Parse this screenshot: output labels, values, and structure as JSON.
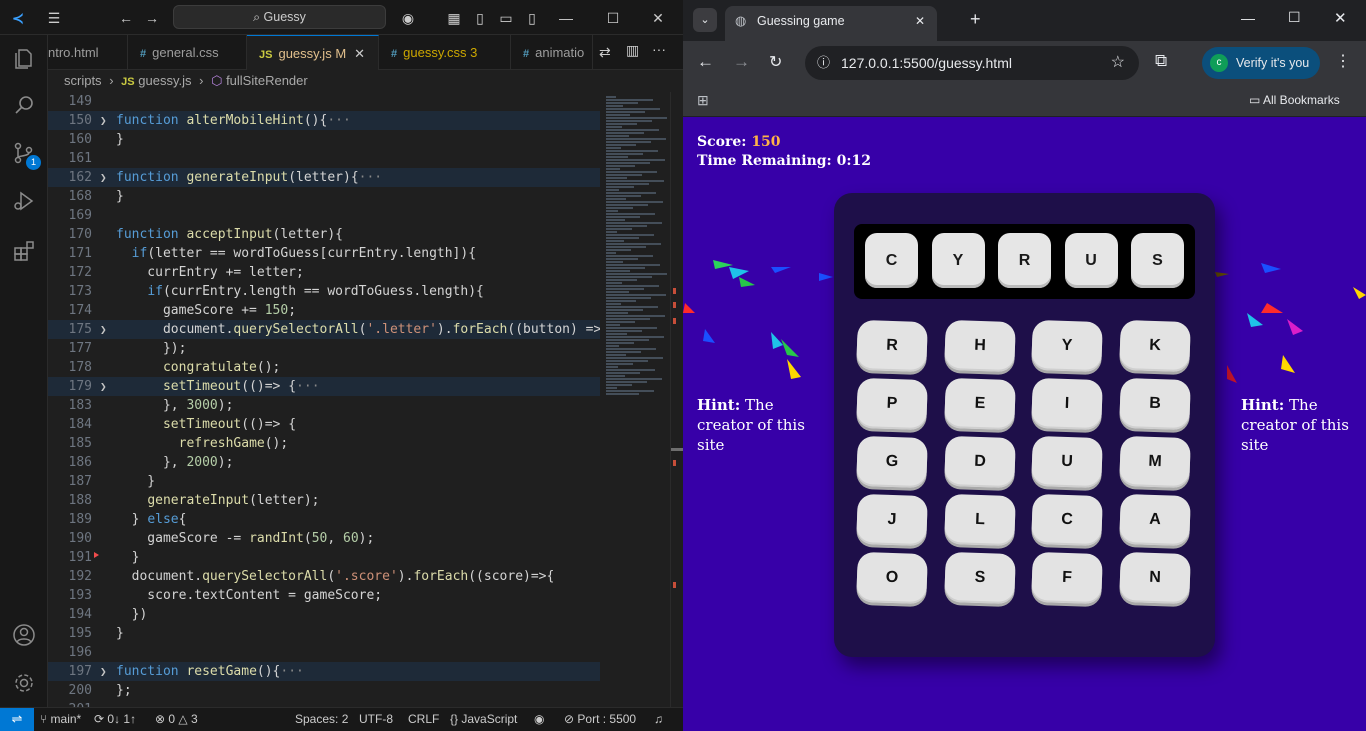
{
  "vscode": {
    "search_label": "Guessy",
    "tabs": [
      {
        "name": "tab-intro-html",
        "label": "ntro.html",
        "ext": "",
        "state": ""
      },
      {
        "name": "tab-general-css",
        "label": "general.css",
        "ext": "#",
        "state": ""
      },
      {
        "name": "tab-guessy-js",
        "label": "guessy.js",
        "ext": "JS",
        "state": "M"
      },
      {
        "name": "tab-guessy-css",
        "label": "guessy.css",
        "ext": "#",
        "state": "3"
      },
      {
        "name": "tab-animation",
        "label": "animatio",
        "ext": "#",
        "state": ""
      }
    ],
    "breadcrumb": {
      "folder": "scripts",
      "file": "guessy.js",
      "symbol": "fullSiteRender"
    },
    "activity_badge": "1",
    "lines": [
      {
        "n": "149",
        "code": ""
      },
      {
        "n": "150",
        "code": "function alterMobileHint(){···"
      },
      {
        "n": "160",
        "code": "}"
      },
      {
        "n": "161",
        "code": ""
      },
      {
        "n": "162",
        "code": "function generateInput(letter){···"
      },
      {
        "n": "168",
        "code": "}"
      },
      {
        "n": "169",
        "code": ""
      },
      {
        "n": "170",
        "code": "function acceptInput(letter){"
      },
      {
        "n": "171",
        "code": "  if(letter == wordToGuess[currEntry.length]){"
      },
      {
        "n": "172",
        "code": "    currEntry += letter;"
      },
      {
        "n": "173",
        "code": "    if(currEntry.length == wordToGuess.length){"
      },
      {
        "n": "174",
        "code": "      gameScore += 150;"
      },
      {
        "n": "175",
        "code": "      document.querySelectorAll('.letter').forEach((button) =>"
      },
      {
        "n": "177",
        "code": "      });"
      },
      {
        "n": "178",
        "code": "      congratulate();"
      },
      {
        "n": "179",
        "code": "      setTimeout(()=> {···"
      },
      {
        "n": "183",
        "code": "      }, 3000);"
      },
      {
        "n": "184",
        "code": "      setTimeout(()=> {"
      },
      {
        "n": "185",
        "code": "        refreshGame();"
      },
      {
        "n": "186",
        "code": "      }, 2000);"
      },
      {
        "n": "187",
        "code": "    }"
      },
      {
        "n": "188",
        "code": "    generateInput(letter);"
      },
      {
        "n": "189",
        "code": "  } else{"
      },
      {
        "n": "190",
        "code": "    gameScore -= randInt(50, 60);"
      },
      {
        "n": "191",
        "code": "  }"
      },
      {
        "n": "192",
        "code": "  document.querySelectorAll('.score').forEach((score)=>{"
      },
      {
        "n": "193",
        "code": "    score.textContent = gameScore;"
      },
      {
        "n": "194",
        "code": "  })"
      },
      {
        "n": "195",
        "code": "}"
      },
      {
        "n": "196",
        "code": ""
      },
      {
        "n": "197",
        "code": "function resetGame(){···"
      },
      {
        "n": "200",
        "code": "};"
      },
      {
        "n": "201",
        "code": ""
      }
    ],
    "status": {
      "branch": "main*",
      "sync": "0↓ 1↑",
      "problems_errors": "0",
      "problems_warnings": "3",
      "spaces": "Spaces: 2",
      "encoding": "UTF-8",
      "eol": "CRLF",
      "language": "JavaScript",
      "port": "Port : 5500"
    }
  },
  "chrome": {
    "tab_title": "Guessing game",
    "url": "127.0.0.1:5500/guessy.html",
    "verify_label": "Verify it's you",
    "avatar_letter": "c",
    "bookmarks_label": "All Bookmarks"
  },
  "game": {
    "score_label": "Score:",
    "score_value": "150",
    "time_label": "Time Remaining:",
    "time_value": "0:12",
    "hint_label": "Hint:",
    "hint_text": "The creator of this site",
    "display_letters": [
      "C",
      "Y",
      "R",
      "U",
      "S"
    ],
    "keys": [
      "R",
      "H",
      "Y",
      "K",
      "P",
      "E",
      "I",
      "B",
      "G",
      "D",
      "U",
      "M",
      "J",
      "L",
      "C",
      "A",
      "O",
      "S",
      "F",
      "N"
    ]
  }
}
